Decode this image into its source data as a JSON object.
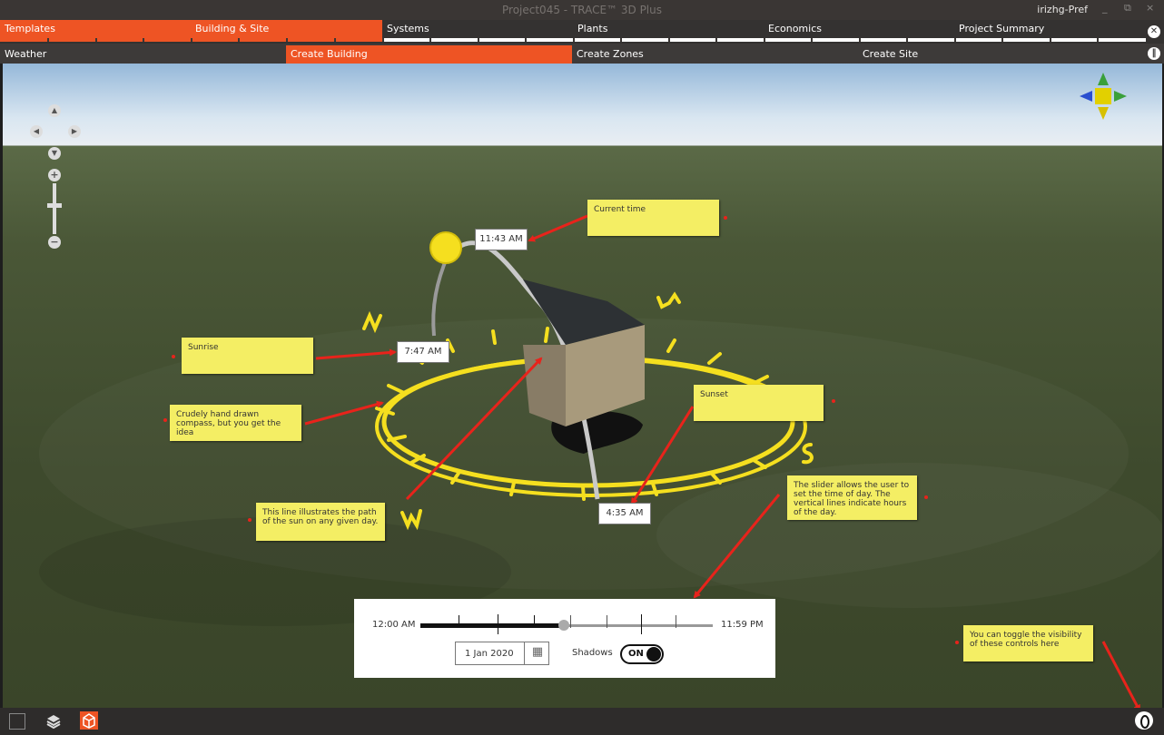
{
  "window": {
    "title": "Project045 - TRACE™ 3D Plus",
    "user": "irizhg-Pref",
    "minimize": "_",
    "restore": "⧉",
    "close": "×"
  },
  "main_tabs": [
    "Templates",
    "Building & Site",
    "Systems",
    "Plants",
    "Economics",
    "Project Summary"
  ],
  "sub_tabs": [
    "Weather",
    "Create Building",
    "Create Zones",
    "Create Site"
  ],
  "time_labels": {
    "current": "11:43 AM",
    "sunrise": "7:47 AM",
    "sunset": "4:35 AM"
  },
  "compass": {
    "n": "N",
    "e": "E",
    "s": "S",
    "w": "W"
  },
  "notes": {
    "current_time": "Current time",
    "sunrise": "Sunrise",
    "sunset": "Sunset",
    "compass": "Crudely hand drawn compass, but you get the idea",
    "sun_path": "This line illustrates the path of the sun on any given day.",
    "slider": "The slider allows the user to set the time of day. The vertical lines indicate hours of the day.",
    "toggle": "You can toggle the visibility of these controls here"
  },
  "slider": {
    "start_label": "12:00 AM",
    "end_label": "11:59 PM",
    "value_fraction": 0.49,
    "date": "1 Jan 2020",
    "shadows_label": "Shadows",
    "shadows_state": "ON"
  },
  "nav_controls": {
    "zoom_in": "+",
    "zoom_out": "−"
  },
  "colors": {
    "accent": "#ee5424",
    "note": "#f4ee64",
    "compass": "#f5df1f",
    "arrow": "#e8231b"
  }
}
